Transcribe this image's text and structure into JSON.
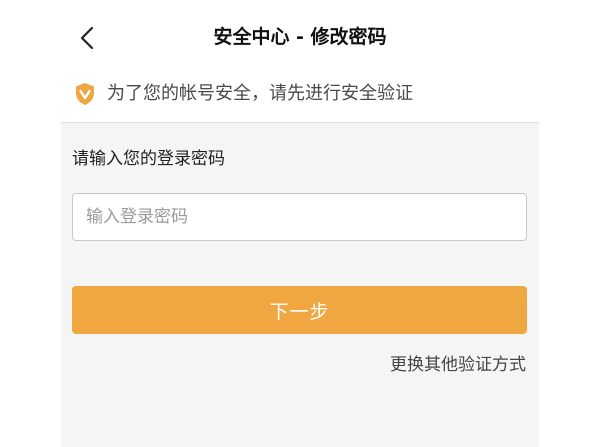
{
  "header": {
    "title": "安全中心 - 修改密码",
    "back_icon": "chevron-left-icon"
  },
  "notice": {
    "icon": "shield-check-icon",
    "icon_color": "#f0a742",
    "text": "为了您的帐号安全，请先进行安全验证"
  },
  "form": {
    "label": "请输入您的登录密码",
    "password": {
      "value": "",
      "placeholder": "输入登录密码"
    },
    "next_label": "下一步",
    "alt_link": "更换其他验证方式"
  },
  "colors": {
    "accent": "#f0a742",
    "panel_background": "#f5f5f5"
  }
}
